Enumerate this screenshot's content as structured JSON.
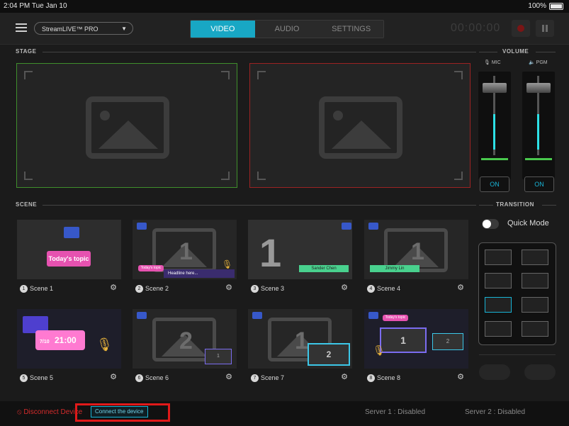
{
  "status_bar": {
    "time": "2:04 PM  Tue Jan 10",
    "battery": "100%"
  },
  "toolbar": {
    "project": "StreamLIVE™ PRO",
    "tabs": [
      "VIDEO",
      "AUDIO",
      "SETTINGS"
    ],
    "active_tab": "VIDEO",
    "timer": "00:00:00"
  },
  "stage": {
    "title": "STAGE"
  },
  "volume": {
    "title": "VOLUME",
    "mic_label": "MIC",
    "pgm_label": "PGM",
    "mic_on": "ON",
    "pgm_on": "ON"
  },
  "scene_section": {
    "title": "SCENE"
  },
  "scenes": [
    {
      "number": "1",
      "name": "Scene 1",
      "pill": "Today's topic",
      "thumb_num": ""
    },
    {
      "number": "2",
      "name": "Scene 2",
      "pill": "Today's topic",
      "thumb_num": "1",
      "headline": "Headline here..."
    },
    {
      "number": "3",
      "name": "Scene 3",
      "thumb_num": "1",
      "lower_third": "Sander Chen"
    },
    {
      "number": "4",
      "name": "Scene 4",
      "thumb_num": "1",
      "lower_third": "Jimmy Lin"
    },
    {
      "number": "5",
      "name": "Scene 5",
      "date": "7/10",
      "clock": "21:00"
    },
    {
      "number": "6",
      "name": "Scene 6",
      "thumb_num": "2",
      "pip": "1"
    },
    {
      "number": "7",
      "name": "Scene 7",
      "thumb_num": "1",
      "pip": "2"
    },
    {
      "number": "8",
      "name": "Scene 8",
      "thumb_num": "1",
      "pip": "2",
      "pill": "Today's topic"
    }
  ],
  "transition": {
    "title": "TRANSITION",
    "quick_mode": "Quick Mode"
  },
  "bottom": {
    "disconnect": "Disconnect Device",
    "connect": "Connect the device",
    "server1": "Server 1 :  Disabled",
    "server2": "Server 2 :  Disabled"
  },
  "colors": {
    "accent": "#18a7c4",
    "stage_left": "#3f8f2c",
    "stage_right": "#9c2323",
    "highlight": "#e01919"
  }
}
